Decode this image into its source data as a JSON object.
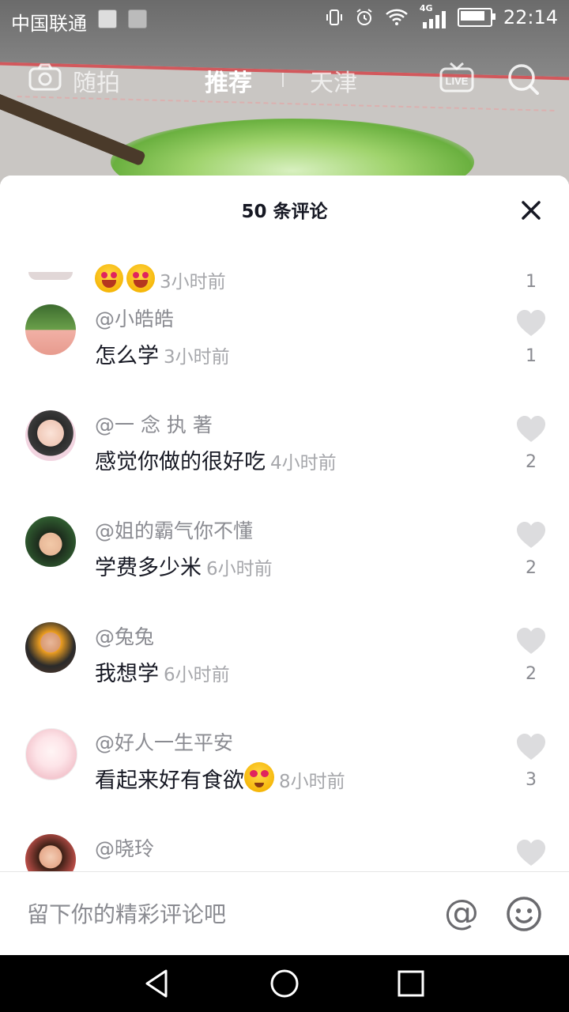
{
  "status_bar": {
    "carrier": "中国联通",
    "network": "4G",
    "time": "22:14"
  },
  "top_nav": {
    "left_label": "随拍",
    "active_tab": "推荐",
    "city_tab": "天津",
    "live_label": "LIVE"
  },
  "sheet": {
    "title": "50 条评论",
    "partial_comment": {
      "time": "3小时前",
      "likes": "1"
    },
    "comments": [
      {
        "user": "@小皓皓",
        "text": "怎么学",
        "time": "3小时前",
        "likes": "1"
      },
      {
        "user": "@一 念 执 著",
        "text": "感觉你做的很好吃",
        "time": "4小时前",
        "likes": "2"
      },
      {
        "user": "@姐的霸气你不懂",
        "text": "学费多少米",
        "time": "6小时前",
        "likes": "2"
      },
      {
        "user": "@兔兔",
        "text": "我想学",
        "time": "6小时前",
        "likes": "2"
      },
      {
        "user": "@好人一生平安",
        "text": "看起来好有食欲",
        "time": "8小时前",
        "likes": "3"
      },
      {
        "user": "@晓玲",
        "text": "",
        "time": "",
        "likes": ""
      }
    ]
  },
  "input_bar": {
    "placeholder": "留下你的精彩评论吧",
    "at_symbol": "@"
  },
  "colors": {
    "text_primary": "#161823",
    "text_secondary": "#8a8b91",
    "heart": "#dcdcde"
  }
}
